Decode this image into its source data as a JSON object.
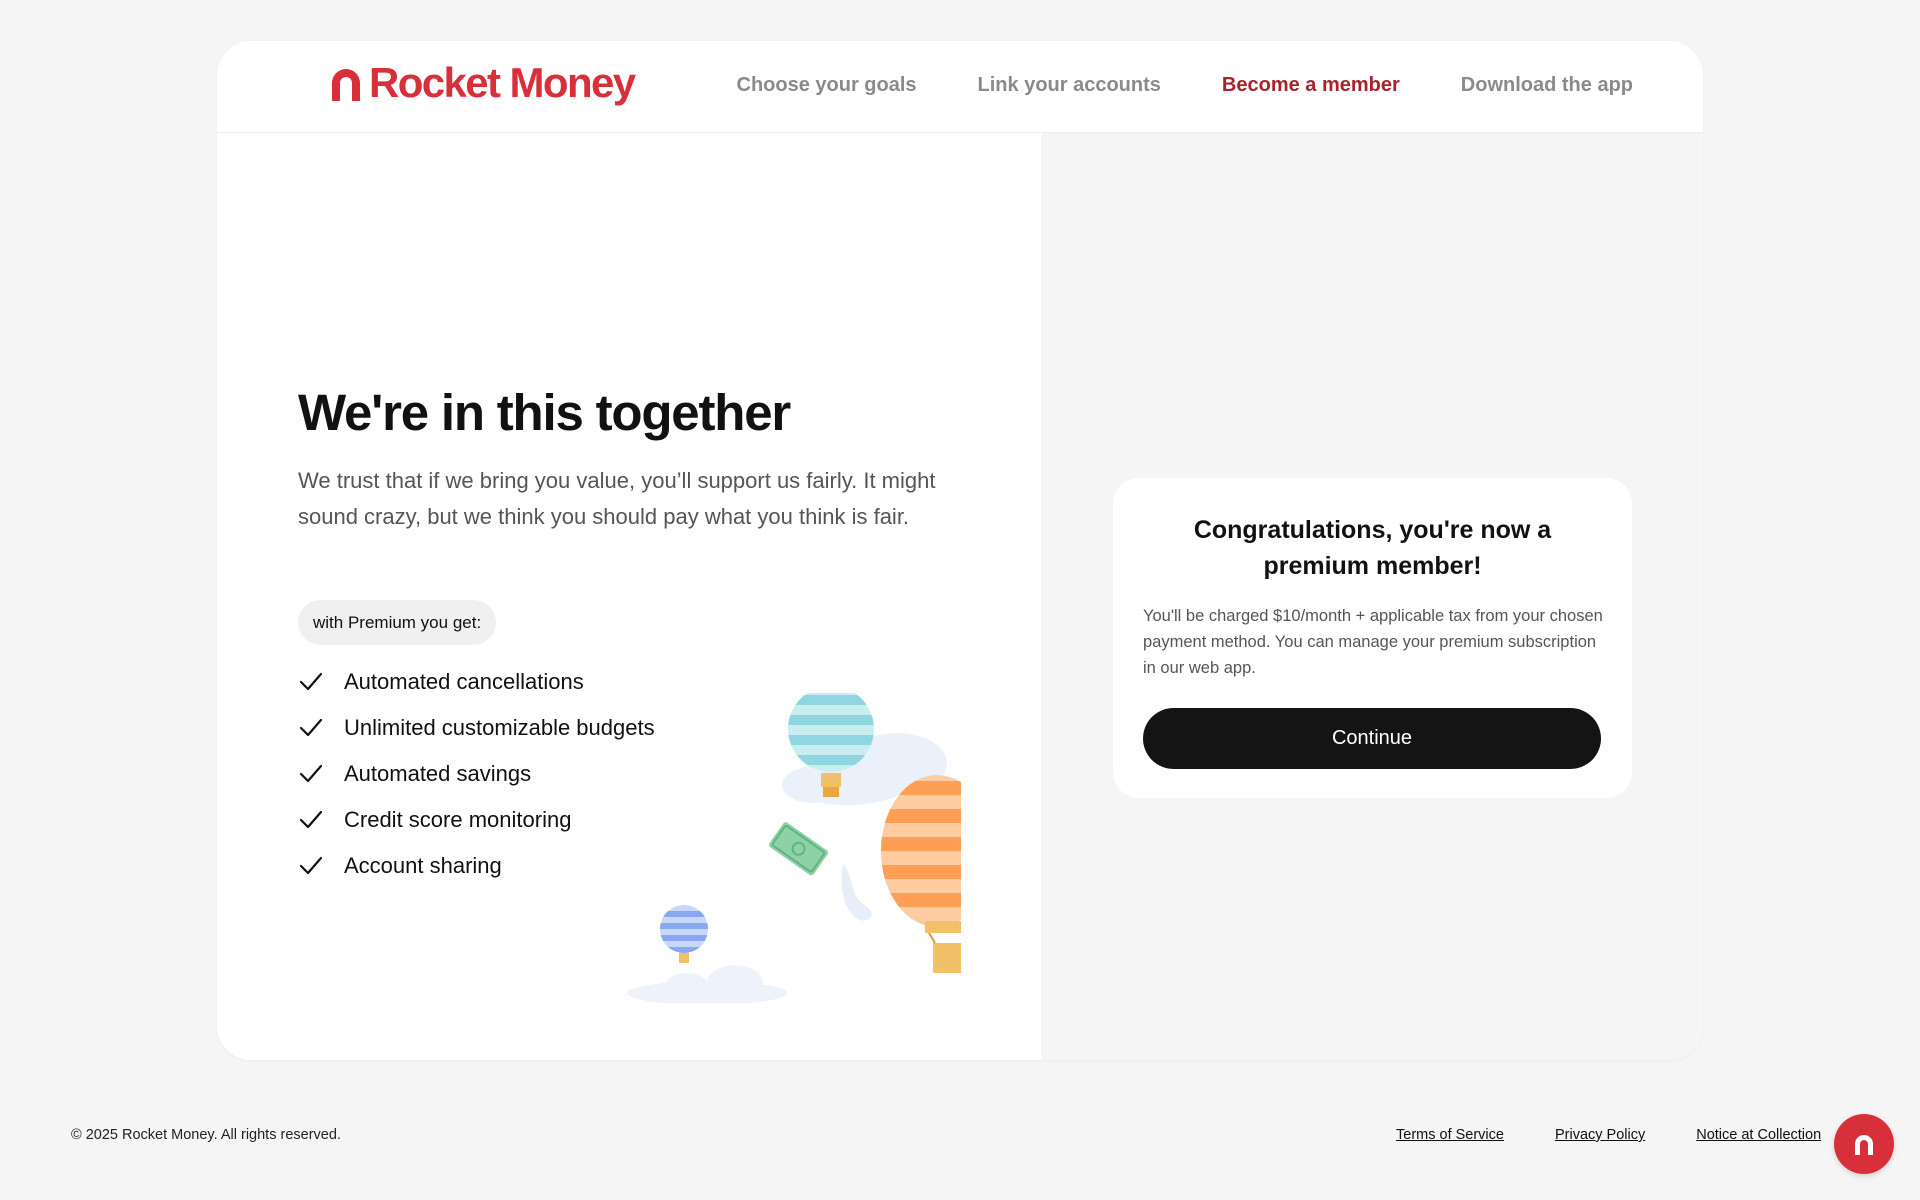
{
  "brand": {
    "name": "Rocket Money",
    "color": "#d8303b"
  },
  "nav": {
    "items": [
      {
        "label": "Choose your goals",
        "active": false
      },
      {
        "label": "Link your accounts",
        "active": false
      },
      {
        "label": "Become a member",
        "active": true
      },
      {
        "label": "Download the app",
        "active": false
      }
    ],
    "active_color": "#a8232e"
  },
  "hero": {
    "title": "We're in this together",
    "description": "We trust that if we bring you value, you’ll support us fairly. It might sound crazy, but we think you should pay what you think is fair.",
    "premium_label": "with Premium you get:",
    "features": [
      "Automated cancellations",
      "Unlimited customizable budgets",
      "Automated savings",
      "Credit score monitoring",
      "Account sharing"
    ],
    "feature_icon": "check-icon"
  },
  "confirmation": {
    "title": "Congratulations, you're now a premium member!",
    "body": "You'll be charged $10/month + applicable tax from your chosen payment method. You can manage your premium subscription in our web app.",
    "button_label": "Continue"
  },
  "footer": {
    "copyright": "© 2025 Rocket Money. All rights reserved.",
    "links": [
      "Terms of Service",
      "Privacy Policy",
      "Notice at Collection"
    ]
  },
  "fab": {
    "icon": "rocket-money-logo-icon"
  }
}
